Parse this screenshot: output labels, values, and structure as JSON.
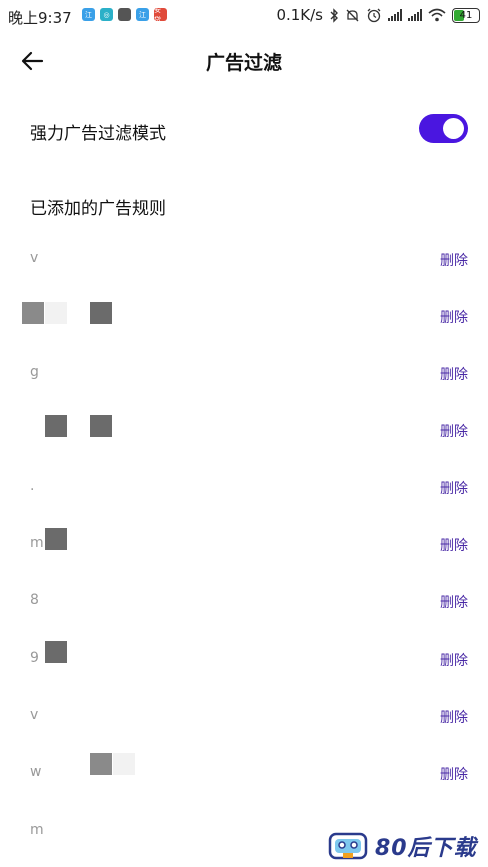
{
  "status_bar": {
    "time": "晚上9:37",
    "speed": "0.1K/s",
    "battery": "41",
    "app_icons": [
      {
        "label": "江",
        "color": "#3aa0e8"
      },
      {
        "label": "◎",
        "color": "#2bb0c8"
      },
      {
        "label": "",
        "color": "#555555"
      },
      {
        "label": "江",
        "color": "#3aa0e8"
      },
      {
        "label": "安贷",
        "color": "#e04a3a"
      }
    ]
  },
  "header": {
    "title": "广告过滤"
  },
  "toggle": {
    "label": "强力广告过滤模式",
    "enabled": true,
    "accent": "#4a16e0"
  },
  "rules_section": {
    "title": "已添加的广告规则",
    "delete_label": "删除",
    "items": [
      {
        "text": "v"
      },
      {
        "text": ""
      },
      {
        "text": "g"
      },
      {
        "text": ""
      },
      {
        "text": "."
      },
      {
        "text": "m"
      },
      {
        "text": "8"
      },
      {
        "text": "9"
      },
      {
        "text": "v"
      },
      {
        "text": "w"
      },
      {
        "text": "m"
      }
    ]
  },
  "watermark": {
    "text": "80后下载"
  }
}
